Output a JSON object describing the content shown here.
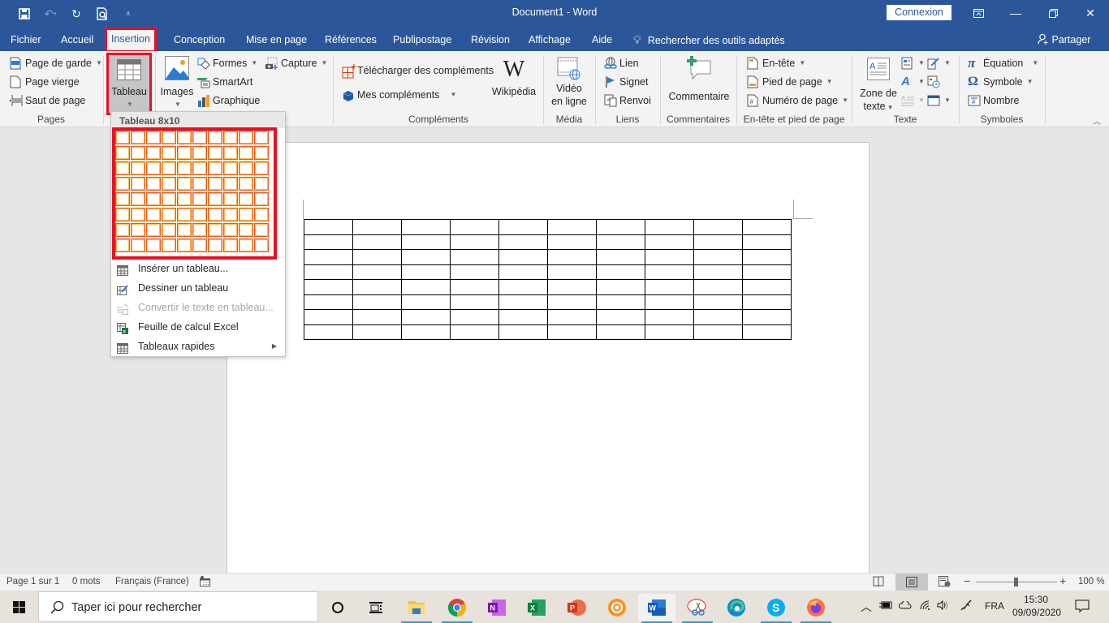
{
  "titlebar": {
    "document_title": "Document1  -  Word",
    "signin_label": "Connexion",
    "quick_access": [
      "save-icon",
      "undo-icon",
      "redo-icon",
      "print-preview-icon",
      "customize-icon"
    ],
    "window_controls": [
      "ribbon-display-options-icon",
      "minimize-icon",
      "restore-icon",
      "close-icon"
    ]
  },
  "menu": {
    "tabs": [
      "Fichier",
      "Accueil",
      "Insertion",
      "Conception",
      "Mise en page",
      "Références",
      "Publipostage",
      "Révision",
      "Affichage",
      "Aide"
    ],
    "active_tab": "Insertion",
    "tell_me": "Rechercher des outils adaptés",
    "share": "Partager"
  },
  "ribbon": {
    "pages": {
      "label": "Pages",
      "items": [
        "Page de garde",
        "Page vierge",
        "Saut de page"
      ]
    },
    "tableaux": {
      "button": "Tableau"
    },
    "illustrations": {
      "images": "Images",
      "items": [
        "Formes",
        "SmartArt",
        "Graphique"
      ],
      "capture": "Capture"
    },
    "complements": {
      "label": "Compléments",
      "download": "Télécharger des compléments",
      "mine": "Mes compléments",
      "wikipedia": "Wikipédia"
    },
    "media": {
      "label": "Média",
      "video_line1": "Vidéo",
      "video_line2": "en ligne"
    },
    "liens": {
      "label": "Liens",
      "items": [
        "Lien",
        "Signet",
        "Renvoi"
      ]
    },
    "commentaires": {
      "label": "Commentaires",
      "button": "Commentaire"
    },
    "entete": {
      "label": "En-tête et pied de page",
      "items": [
        "En-tête",
        "Pied de page",
        "Numéro de page"
      ]
    },
    "texte": {
      "label": "Texte",
      "zone_line1": "Zone de",
      "zone_line2": "texte"
    },
    "symboles": {
      "label": "Symboles",
      "items": [
        "Équation",
        "Symbole",
        "Nombre"
      ]
    }
  },
  "table_dropdown": {
    "header": "Tableau 8x10",
    "grid_rows": 8,
    "grid_cols": 10,
    "selected_rows": 8,
    "selected_cols": 10,
    "items": [
      {
        "label": "Insérer un tableau...",
        "icon": "insert-table-icon",
        "enabled": true,
        "submenu": false
      },
      {
        "label": "Dessiner un tableau",
        "icon": "draw-table-icon",
        "enabled": true,
        "submenu": false
      },
      {
        "label": "Convertir le texte en tableau...",
        "icon": "convert-text-icon",
        "enabled": false,
        "submenu": false
      },
      {
        "label": "Feuille de calcul Excel",
        "icon": "excel-sheet-icon",
        "enabled": true,
        "submenu": false
      },
      {
        "label": "Tableaux rapides",
        "icon": "quick-tables-icon",
        "enabled": true,
        "submenu": true
      }
    ]
  },
  "document": {
    "table_rows": 8,
    "table_cols": 10
  },
  "statusbar": {
    "page": "Page 1 sur 1",
    "words": "0 mots",
    "language": "Français (France)",
    "zoom_percent": "100 %",
    "zoom_minus": "−",
    "zoom_plus": "+"
  },
  "taskbar": {
    "search_placeholder": "Taper ici pour rechercher",
    "apps": [
      "File Explorer",
      "Chrome",
      "OneNote",
      "Excel",
      "PowerPoint",
      "Settings",
      "Word",
      "Snipping Tool",
      "Edge",
      "Skype",
      "Firefox"
    ],
    "language": "FRA",
    "time": "15:30",
    "date": "09/09/2020"
  }
}
